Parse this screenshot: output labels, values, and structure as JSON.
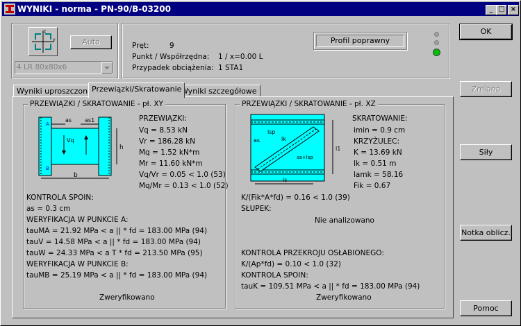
{
  "window": {
    "title": "WYNIKI - norma - PN-90/B-03200"
  },
  "titlebar_buttons": {
    "minimize": "_",
    "maximize": "□",
    "close": "×"
  },
  "left_top": {
    "auto_label": "Auto",
    "profile_select": "4 LR 80x80x6",
    "section_icon_label": "z y"
  },
  "info": {
    "pret_label": "Pręt:",
    "pret_value": "9",
    "punkt_label": "Punkt / Współrzędna:",
    "punkt_value": "1 / x=0.00 L",
    "przypadek_label": "Przypadek obciążenia:",
    "przypadek_value": "1 STA1",
    "status": "Profil poprawny"
  },
  "buttons": {
    "ok": "OK",
    "zmiana": "Zmiana",
    "sily": "Siły",
    "notka": "Notka oblicz.",
    "pomoc": "Pomoc"
  },
  "tabs": [
    "Wyniki uproszczone",
    "Przewiązki/Skratowanie",
    "Wyniki szczegółowe"
  ],
  "left_group": {
    "title": "PRZEWIĄZKI / SKRATOWANIE - pł. XY",
    "section_title": "PRZEWIĄZKI:",
    "values": [
      "Vq = 8.53 kN",
      "Vr = 186.28 kN",
      "Mq = 1.52 kN*m",
      "Mr = 11.60 kN*m",
      "Vq/Vr = 0.05 < 1.0 (53)",
      "Mq/Mr = 0.13 < 1.0 (52)"
    ],
    "lines": [
      "KONTROLA SPOIN:",
      "as = 0.3 cm",
      "WERYFIKACJA W PUNKCIE A:",
      "tauMA = 21.92 MPa < a || * fd = 183.00 MPa  (94)",
      "tauV = 14.58 MPa < a || * fd = 183.00 MPa  (94)",
      "tauW = 24.33 MPa < a T * fd = 213.50 MPa  (95)",
      "WERYFIKACJA W PUNKCIE B:",
      "tauMB = 25.19 MPa < a || * fd = 183.00 MPa  (94)"
    ],
    "verdict": "Zweryfikowano",
    "drawing_labels": {
      "as": "as",
      "as1": "as1",
      "A": "A",
      "B": "B",
      "h": "h",
      "b": "b",
      "vq": "Vq"
    }
  },
  "right_group": {
    "title": "PRZEWIĄZKI / SKRATOWANIE - pł. XZ",
    "section_title": "SKRATOWANIE:",
    "values": [
      "imin = 0.9 cm",
      "KRZYŻULEC:",
      "K = 13.69 kN",
      "lk = 0.51 m",
      "lamk = 58.16",
      "Fik = 0.67"
    ],
    "lines": [
      "K/(Fik*A*fd) = 0.16 < 1.0 (39)",
      "SŁUPEK:"
    ],
    "not_analyzed": "Nie analizowano",
    "lines2": [
      "KONTROLA PRZEKROJU OSŁABIONEGO:",
      "K/(Ap*fd) = 0.10 < 1.0 (32)",
      "KONTROLA SPOIN:",
      "tauK = 109.51 MPa < a || * fd = 183.00 MPa  (94)"
    ],
    "verdict": "Zweryfikowano",
    "drawing_labels": {
      "lsp": "lsp",
      "lk": "lk",
      "as": "as",
      "aslsp": "as+lsp",
      "l1": "l1",
      "ls": "ls"
    }
  },
  "colors": {
    "titlebar": "#000080",
    "drawing_fill": "#00ffff",
    "led_green": "#00c000"
  }
}
